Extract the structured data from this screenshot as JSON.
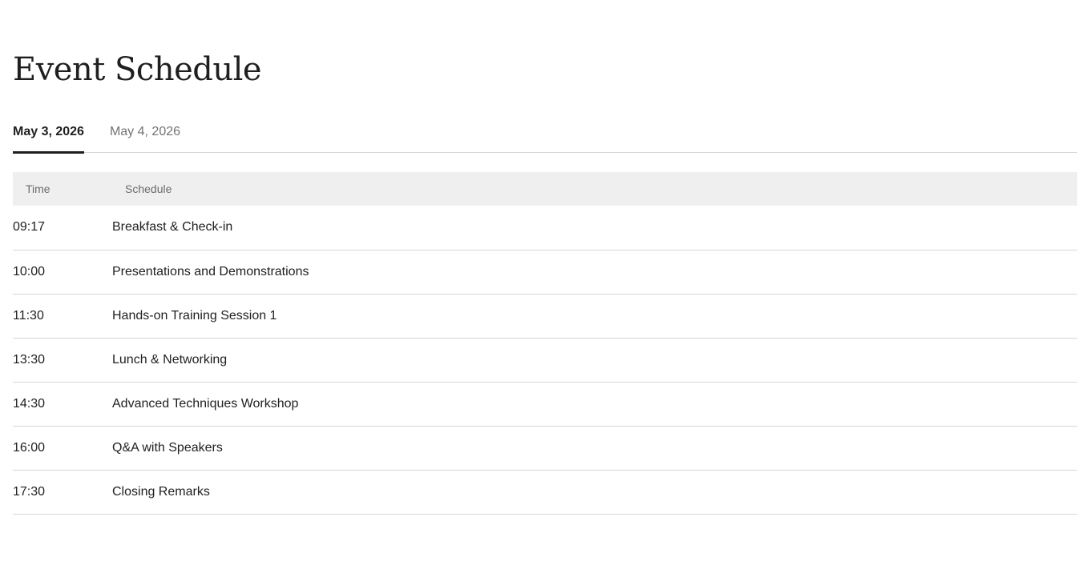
{
  "page": {
    "title": "Event Schedule"
  },
  "tabs": [
    {
      "label": "May 3, 2026",
      "active": true
    },
    {
      "label": "May 4, 2026",
      "active": false
    }
  ],
  "table": {
    "headers": {
      "time": "Time",
      "schedule": "Schedule"
    },
    "rows": [
      {
        "time": "09:17",
        "title": "Breakfast & Check-in"
      },
      {
        "time": "10:00",
        "title": "Presentations and Demonstrations"
      },
      {
        "time": "11:30",
        "title": "Hands-on Training Session 1"
      },
      {
        "time": "13:30",
        "title": "Lunch & Networking"
      },
      {
        "time": "14:30",
        "title": "Advanced Techniques Workshop"
      },
      {
        "time": "16:00",
        "title": "Q&A with Speakers"
      },
      {
        "time": "17:30",
        "title": "Closing Remarks"
      }
    ]
  },
  "colors": {
    "text": "#1f1f1f",
    "muted": "#737373",
    "header_bg": "#efefef",
    "divider": "#d6d6d6"
  }
}
